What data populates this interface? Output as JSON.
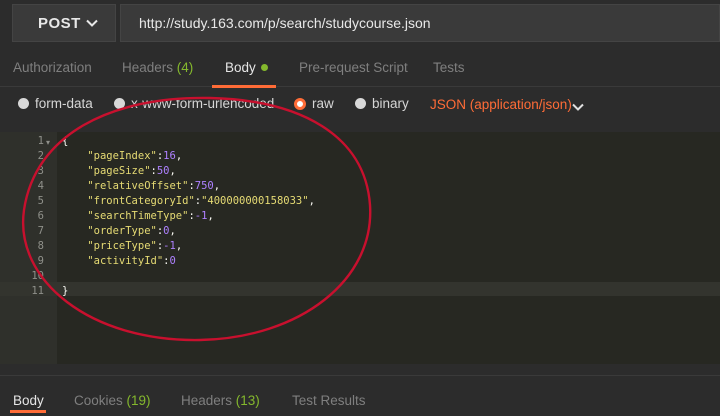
{
  "request": {
    "method": "POST",
    "url": "http://study.163.com/p/search/studycourse.json"
  },
  "request_tabs": [
    {
      "label": "Authorization",
      "count": ""
    },
    {
      "label": "Headers",
      "count": "(4)"
    },
    {
      "label": "Body",
      "count": ""
    },
    {
      "label": "Pre-request Script",
      "count": ""
    },
    {
      "label": "Tests",
      "count": ""
    }
  ],
  "body_modes": {
    "form_data": "form-data",
    "urlencoded": "x-www-form-urlencoded",
    "raw": "raw",
    "binary": "binary",
    "selected": "raw",
    "content_type": "JSON (application/json)"
  },
  "editor": {
    "line_numbers": [
      "1",
      "2",
      "3",
      "4",
      "5",
      "6",
      "7",
      "8",
      "9",
      "10",
      "11"
    ],
    "lines": [
      {
        "key": "",
        "value": "",
        "open": "{"
      },
      {
        "key": "\"pageIndex\"",
        "value": "16",
        "comma": ","
      },
      {
        "key": "\"pageSize\"",
        "value": "50",
        "comma": ","
      },
      {
        "key": "\"relativeOffset\"",
        "value": "750",
        "comma": ","
      },
      {
        "key": "\"frontCategoryId\"",
        "value": "\"400000000158033\"",
        "comma": ","
      },
      {
        "key": "\"searchTimeType\"",
        "value": "-1",
        "comma": ","
      },
      {
        "key": "\"orderType\"",
        "value": "0",
        "comma": ","
      },
      {
        "key": "\"priceType\"",
        "value": "-1",
        "comma": ","
      },
      {
        "key": "\"activityId\"",
        "value": "0",
        "comma": ""
      },
      {
        "key": "",
        "value": "",
        "open": ""
      },
      {
        "key": "",
        "value": "",
        "open": "}"
      }
    ]
  },
  "response_tabs": [
    {
      "label": "Body",
      "count": ""
    },
    {
      "label": "Cookies",
      "count": "(19)"
    },
    {
      "label": "Headers",
      "count": "(13)"
    },
    {
      "label": "Test Results",
      "count": ""
    }
  ],
  "colors": {
    "accent": "#ff6c37",
    "count_green": "#84b82d",
    "annotation_red": "#c8102e"
  }
}
